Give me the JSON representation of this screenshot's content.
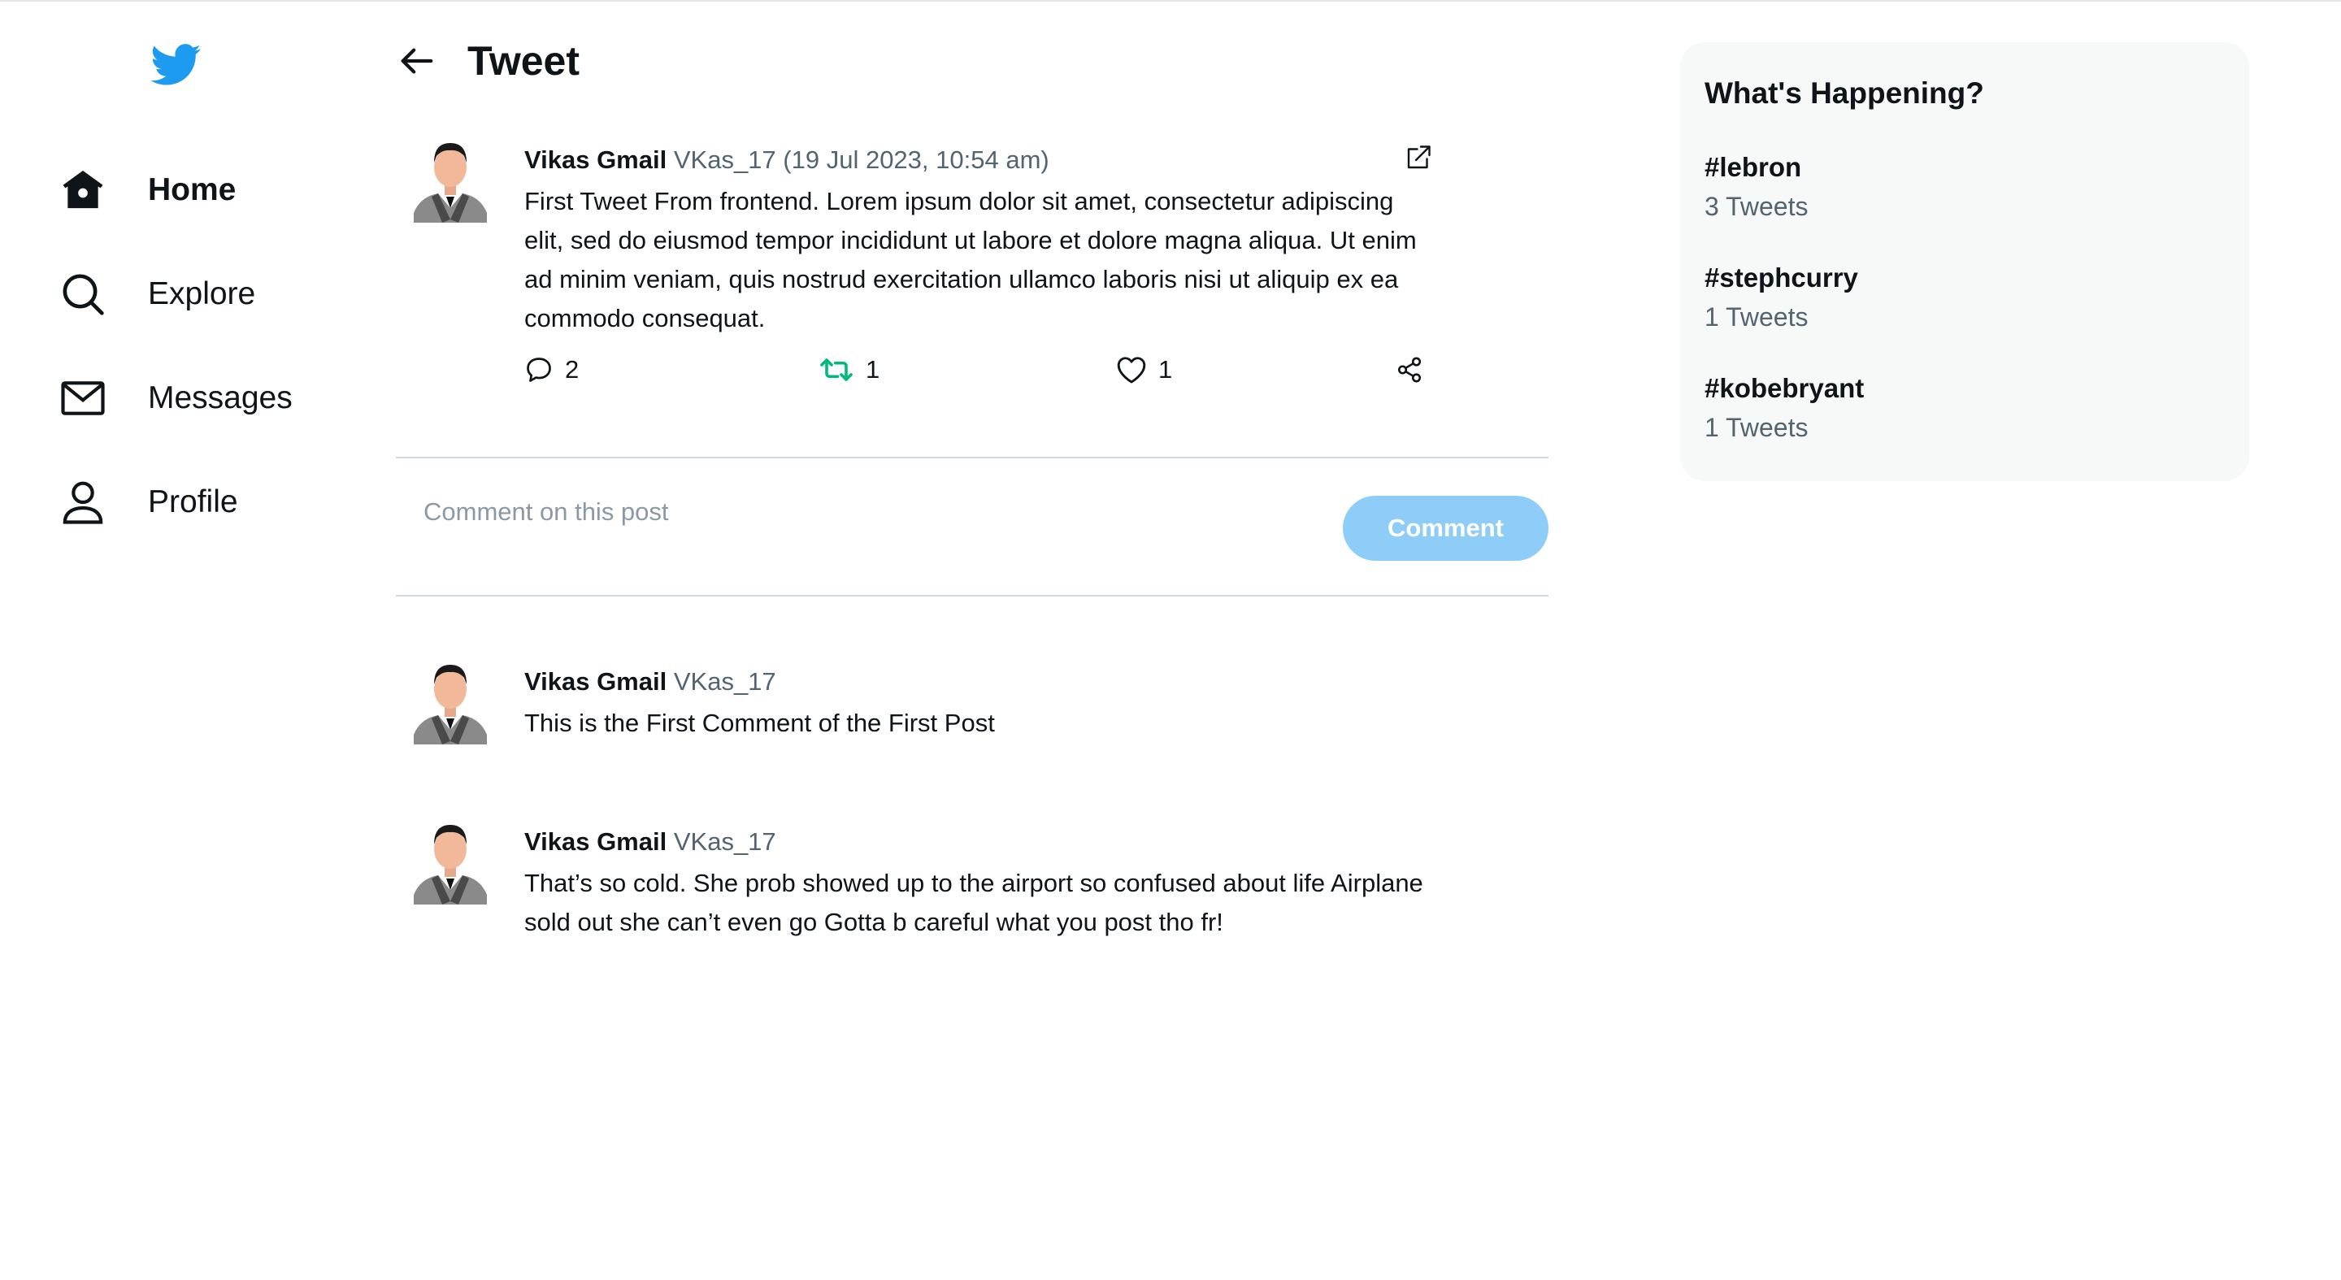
{
  "colors": {
    "brand": "#1d9bf0",
    "retweet_active": "#00ba7c",
    "comment_button_disabled": "#8ecdf8",
    "muted_text": "#536471",
    "panel_bg": "#f7f9f9"
  },
  "sidebar": {
    "logo_icon": "twitter-bird-icon",
    "items": [
      {
        "label": "Home",
        "icon": "home-icon",
        "active": true
      },
      {
        "label": "Explore",
        "icon": "search-icon",
        "active": false
      },
      {
        "label": "Messages",
        "icon": "envelope-icon",
        "active": false
      },
      {
        "label": "Profile",
        "icon": "user-icon",
        "active": false
      }
    ]
  },
  "header": {
    "title": "Tweet",
    "back_icon": "arrow-left-icon"
  },
  "post": {
    "author_name": "Vikas Gmail",
    "author_handle": "VKas_17",
    "timestamp": "(19 Jul 2023, 10:54 am)",
    "text": "First Tweet From frontend. Lorem ipsum dolor sit amet, consectetur adipiscing elit, sed do eiusmod tempor incididunt ut labore et dolore magna aliqua. Ut enim ad minim veniam, quis nostrud exercitation ullamco laboris nisi ut aliquip ex ea commodo consequat.",
    "reply_count": "2",
    "retweet_count": "1",
    "like_count": "1"
  },
  "comment_box": {
    "placeholder": "Comment on this post",
    "value": "",
    "button_label": "Comment"
  },
  "comments": [
    {
      "author_name": "Vikas Gmail",
      "author_handle": "VKas_17",
      "text": "This is the First Comment of the First Post"
    },
    {
      "author_name": "Vikas Gmail",
      "author_handle": "VKas_17",
      "text": "That’s so cold. She prob showed up to the airport so confused about life Airplane sold out she can’t even go Gotta b careful what you post tho fr!"
    }
  ],
  "trends": {
    "title": "What's Happening?",
    "items": [
      {
        "tag": "#lebron",
        "count": "3 Tweets"
      },
      {
        "tag": "#stephcurry",
        "count": "1 Tweets"
      },
      {
        "tag": "#kobebryant",
        "count": "1 Tweets"
      }
    ]
  }
}
